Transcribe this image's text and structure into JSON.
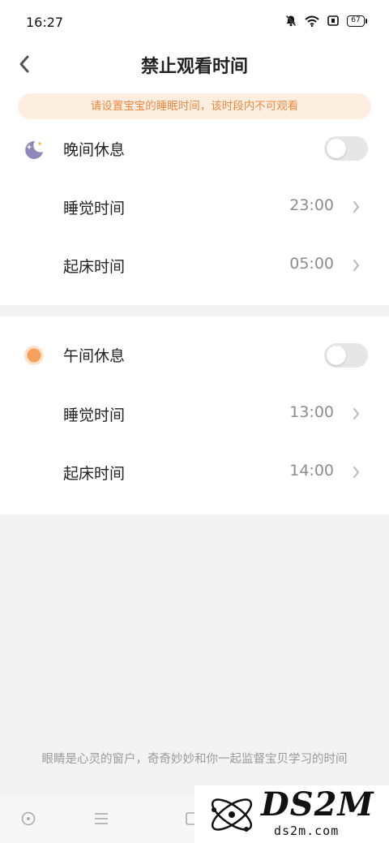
{
  "status_bar": {
    "time": "16:27",
    "battery": "67",
    "icons": [
      "mute-bell-icon",
      "wifi-icon",
      "sim-icon",
      "battery-icon"
    ]
  },
  "header": {
    "title": "禁止观看时间",
    "back_icon": "chevron-left-icon"
  },
  "banner": {
    "text": "请设置宝宝的睡眠时间，该时段内不可观看"
  },
  "night": {
    "title": "晚间休息",
    "icon": "moon-stars-icon",
    "enabled": false,
    "sleep_label": "睡觉时间",
    "sleep_time": "23:00",
    "wake_label": "起床时间",
    "wake_time": "05:00"
  },
  "noon": {
    "title": "午间休息",
    "icon": "sun-icon",
    "enabled": false,
    "sleep_label": "睡觉时间",
    "sleep_time": "13:00",
    "wake_label": "起床时间",
    "wake_time": "14:00"
  },
  "footer": {
    "note": "眼睛是心灵的窗户，奇奇妙妙和你一起监督宝贝学习的时间"
  },
  "nav": {
    "buttons": [
      "circle-dot-icon",
      "menu-icon",
      "square-icon"
    ]
  },
  "watermark": {
    "text": "DS2M",
    "sub": "ds2m.com"
  },
  "colors": {
    "accent": "#ea8a3f",
    "banner_bg": "#fdeee2",
    "toggle_off": "#e6e6e6",
    "moon": "#8e88b8",
    "sun": "#f5a15c"
  }
}
